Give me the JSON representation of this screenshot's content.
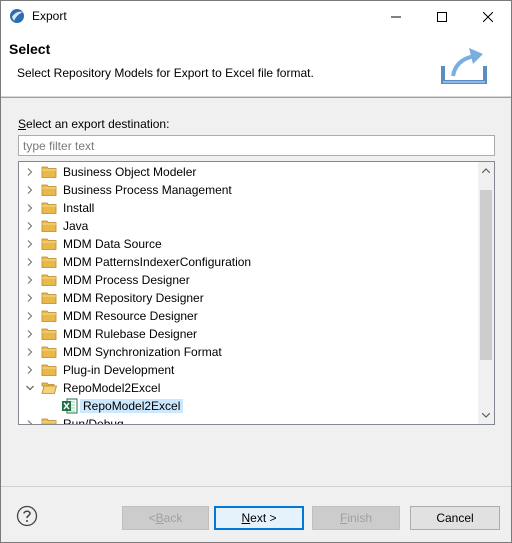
{
  "window": {
    "title": "Export",
    "minimize_label": "minimize",
    "maximize_label": "maximize",
    "close_label": "close"
  },
  "banner": {
    "title": "Select",
    "description": "Select Repository Models for Export to Excel file format."
  },
  "destination": {
    "label_accel": "S",
    "label_rest": "elect an export destination:",
    "filter_placeholder": "type filter text",
    "filter_value": ""
  },
  "tree": {
    "items": [
      {
        "label": "Business Object Modeler",
        "expanded": false
      },
      {
        "label": "Business Process Management",
        "expanded": false
      },
      {
        "label": "Install",
        "expanded": false
      },
      {
        "label": "Java",
        "expanded": false
      },
      {
        "label": "MDM Data Source",
        "expanded": false
      },
      {
        "label": "MDM PatternsIndexerConfiguration",
        "expanded": false
      },
      {
        "label": "MDM Process Designer",
        "expanded": false
      },
      {
        "label": "MDM Repository Designer",
        "expanded": false
      },
      {
        "label": "MDM Resource Designer",
        "expanded": false
      },
      {
        "label": "MDM Rulebase Designer",
        "expanded": false
      },
      {
        "label": "MDM Synchronization Format",
        "expanded": false
      },
      {
        "label": "Plug-in Development",
        "expanded": false
      },
      {
        "label": "RepoModel2Excel",
        "expanded": true
      },
      {
        "label": "RepoModel2Excel",
        "child": true,
        "selected": true
      },
      {
        "label": "Run/Debug",
        "expanded": false
      }
    ]
  },
  "buttons": {
    "back_pre": "< ",
    "back_accel": "B",
    "back_post": "ack",
    "next_accel": "N",
    "next_post": "ext >",
    "finish_accel": "F",
    "finish_post": "inish",
    "cancel": "Cancel"
  },
  "colors": {
    "accent": "#0078d7",
    "selection": "#cce8ff",
    "folder": "#e8b84a"
  }
}
